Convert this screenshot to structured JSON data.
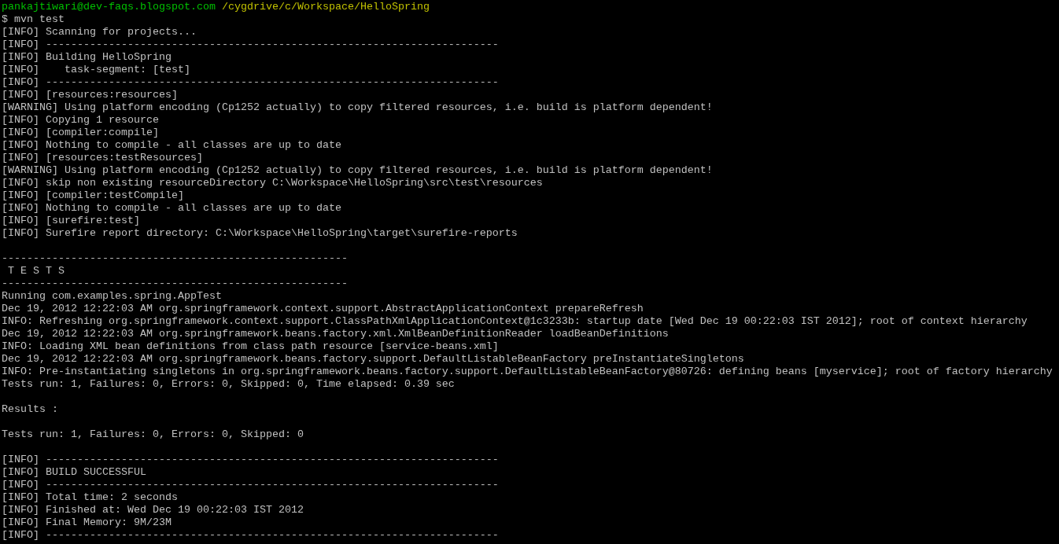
{
  "terminal": {
    "lines": [
      {
        "kind": "prompt",
        "user": "pankajtiwari@dev-faqs.blogspot.com",
        "path": "/cygdrive/c/Workspace/HelloSpring"
      },
      {
        "kind": "text",
        "text": "$ mvn test"
      },
      {
        "kind": "text",
        "text": "[INFO] Scanning for projects..."
      },
      {
        "kind": "text",
        "text": "[INFO] ------------------------------------------------------------------------"
      },
      {
        "kind": "text",
        "text": "[INFO] Building HelloSpring"
      },
      {
        "kind": "text",
        "text": "[INFO]    task-segment: [test]"
      },
      {
        "kind": "text",
        "text": "[INFO] ------------------------------------------------------------------------"
      },
      {
        "kind": "text",
        "text": "[INFO] [resources:resources]"
      },
      {
        "kind": "text",
        "text": "[WARNING] Using platform encoding (Cp1252 actually) to copy filtered resources, i.e. build is platform dependent!"
      },
      {
        "kind": "text",
        "text": "[INFO] Copying 1 resource"
      },
      {
        "kind": "text",
        "text": "[INFO] [compiler:compile]"
      },
      {
        "kind": "text",
        "text": "[INFO] Nothing to compile - all classes are up to date"
      },
      {
        "kind": "text",
        "text": "[INFO] [resources:testResources]"
      },
      {
        "kind": "text",
        "text": "[WARNING] Using platform encoding (Cp1252 actually) to copy filtered resources, i.e. build is platform dependent!"
      },
      {
        "kind": "text",
        "text": "[INFO] skip non existing resourceDirectory C:\\Workspace\\HelloSpring\\src\\test\\resources"
      },
      {
        "kind": "text",
        "text": "[INFO] [compiler:testCompile]"
      },
      {
        "kind": "text",
        "text": "[INFO] Nothing to compile - all classes are up to date"
      },
      {
        "kind": "text",
        "text": "[INFO] [surefire:test]"
      },
      {
        "kind": "text",
        "text": "[INFO] Surefire report directory: C:\\Workspace\\HelloSpring\\target\\surefire-reports"
      },
      {
        "kind": "blank"
      },
      {
        "kind": "text",
        "text": "-------------------------------------------------------"
      },
      {
        "kind": "text",
        "text": " T E S T S"
      },
      {
        "kind": "text",
        "text": "-------------------------------------------------------"
      },
      {
        "kind": "text",
        "text": "Running com.examples.spring.AppTest"
      },
      {
        "kind": "text",
        "text": "Dec 19, 2012 12:22:03 AM org.springframework.context.support.AbstractApplicationContext prepareRefresh"
      },
      {
        "kind": "text",
        "text": "INFO: Refreshing org.springframework.context.support.ClassPathXmlApplicationContext@1c3233b: startup date [Wed Dec 19 00:22:03 IST 2012]; root of context hierarchy"
      },
      {
        "kind": "text",
        "text": "Dec 19, 2012 12:22:03 AM org.springframework.beans.factory.xml.XmlBeanDefinitionReader loadBeanDefinitions"
      },
      {
        "kind": "text",
        "text": "INFO: Loading XML bean definitions from class path resource [service-beans.xml]"
      },
      {
        "kind": "text",
        "text": "Dec 19, 2012 12:22:03 AM org.springframework.beans.factory.support.DefaultListableBeanFactory preInstantiateSingletons"
      },
      {
        "kind": "text",
        "text": "INFO: Pre-instantiating singletons in org.springframework.beans.factory.support.DefaultListableBeanFactory@80726: defining beans [myservice]; root of factory hierarchy"
      },
      {
        "kind": "text",
        "text": "Tests run: 1, Failures: 0, Errors: 0, Skipped: 0, Time elapsed: 0.39 sec"
      },
      {
        "kind": "blank"
      },
      {
        "kind": "text",
        "text": "Results :"
      },
      {
        "kind": "blank"
      },
      {
        "kind": "text",
        "text": "Tests run: 1, Failures: 0, Errors: 0, Skipped: 0"
      },
      {
        "kind": "blank"
      },
      {
        "kind": "text",
        "text": "[INFO] ------------------------------------------------------------------------"
      },
      {
        "kind": "text",
        "text": "[INFO] BUILD SUCCESSFUL"
      },
      {
        "kind": "text",
        "text": "[INFO] ------------------------------------------------------------------------"
      },
      {
        "kind": "text",
        "text": "[INFO] Total time: 2 seconds"
      },
      {
        "kind": "text",
        "text": "[INFO] Finished at: Wed Dec 19 00:22:03 IST 2012"
      },
      {
        "kind": "text",
        "text": "[INFO] Final Memory: 9M/23M"
      },
      {
        "kind": "text",
        "text": "[INFO] ------------------------------------------------------------------------"
      }
    ]
  }
}
